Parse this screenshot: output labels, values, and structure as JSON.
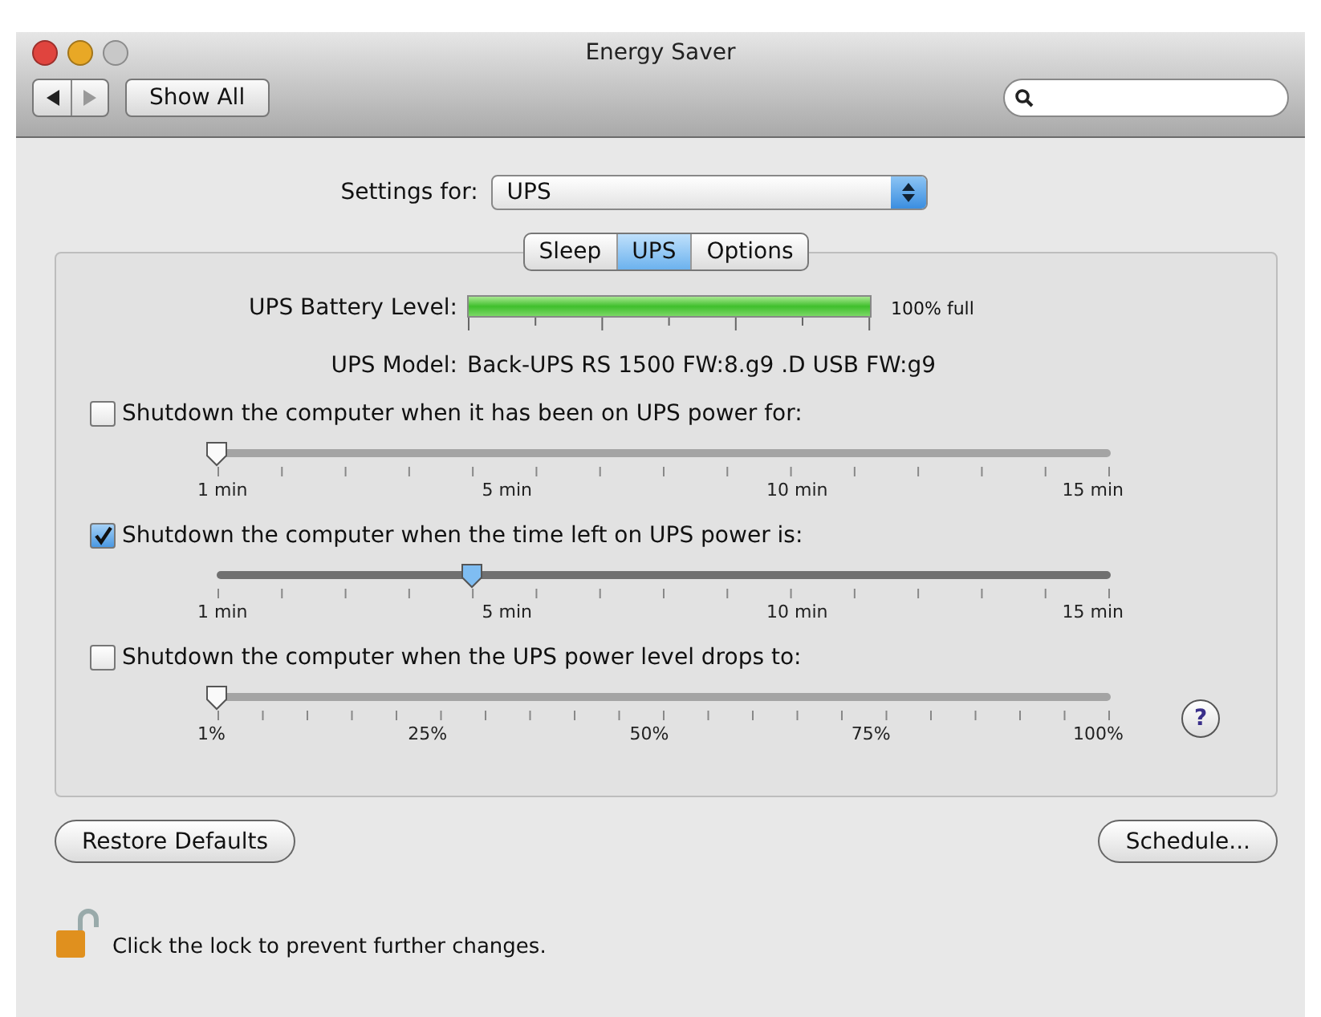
{
  "window": {
    "title": "Energy Saver"
  },
  "toolbar": {
    "show_all": "Show All"
  },
  "settings_for": {
    "label": "Settings for:",
    "value": "UPS"
  },
  "tabs": [
    {
      "label": "Sleep",
      "selected": false
    },
    {
      "label": "UPS",
      "selected": true
    },
    {
      "label": "Options",
      "selected": false
    }
  ],
  "battery": {
    "label": "UPS Battery Level:",
    "level": 1,
    "reading": "100% full"
  },
  "model": {
    "label": "UPS Model:",
    "value": "Back-UPS RS 1500 FW:8.g9 .D USB FW:g9"
  },
  "options": [
    {
      "label": "Shutdown the computer when it has been on UPS power for:",
      "checked": false,
      "level": 0,
      "kind": "minutes",
      "tick_labels": [
        "1 min",
        "5 min",
        "10 min",
        "15 min"
      ]
    },
    {
      "label": "Shutdown the computer when the time left on UPS power is:",
      "checked": true,
      "level": 0.286,
      "kind": "minutes",
      "tick_labels": [
        "1 min",
        "5 min",
        "10 min",
        "15 min"
      ]
    },
    {
      "label": "Shutdown the computer when the UPS power level drops to:",
      "checked": false,
      "level": 0,
      "kind": "percent",
      "tick_labels": [
        "1%",
        "25%",
        "50%",
        "75%",
        "100%"
      ]
    }
  ],
  "help": "?",
  "buttons": {
    "restore": "Restore Defaults",
    "schedule": "Schedule..."
  },
  "lock": {
    "text": "Click the lock to prevent further changes."
  }
}
